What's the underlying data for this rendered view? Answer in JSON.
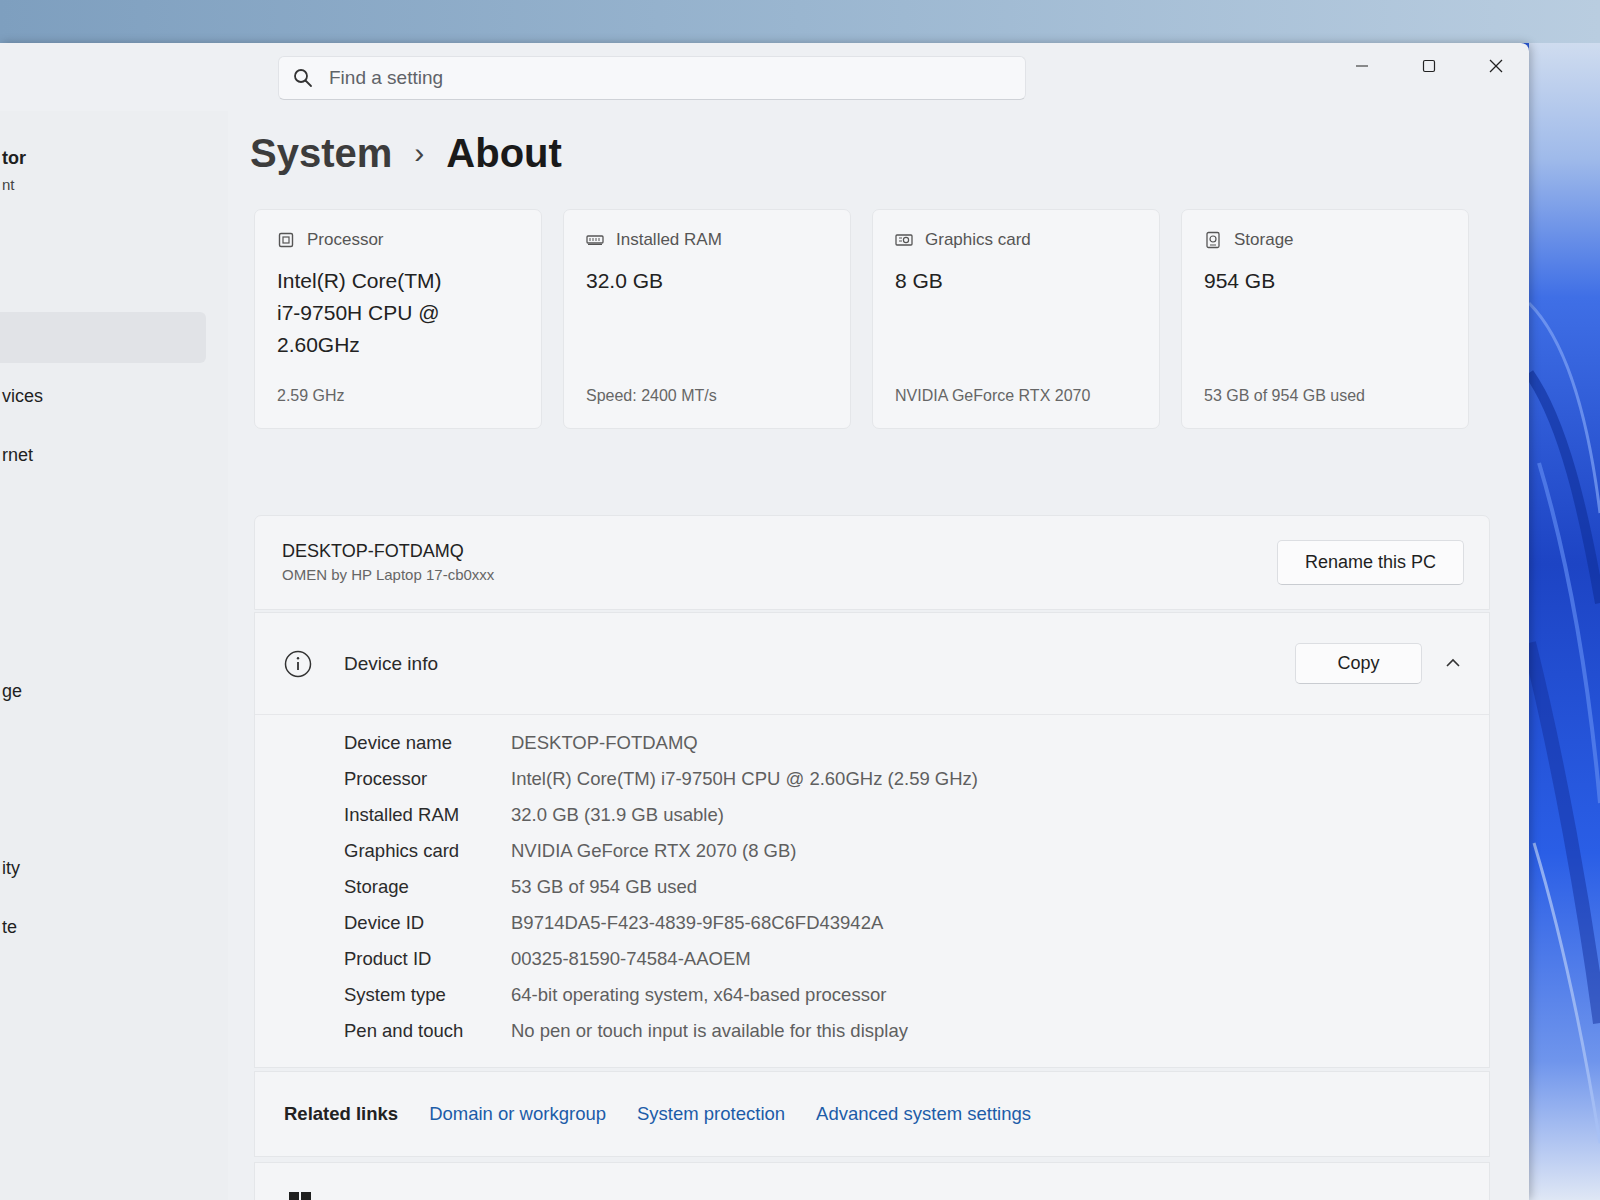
{
  "search": {
    "placeholder": "Find a setting"
  },
  "sidebar": {
    "profile": {
      "name": "tor",
      "account": "nt"
    },
    "items": [
      {
        "label": "",
        "selected": true
      },
      {
        "label": "vices",
        "selected": false
      },
      {
        "label": "rnet",
        "selected": false
      },
      {
        "label": "",
        "selected": false
      },
      {
        "label": "",
        "selected": false
      },
      {
        "label": "",
        "selected": false
      },
      {
        "label": "ge",
        "selected": false
      },
      {
        "label": "",
        "selected": false
      },
      {
        "label": "",
        "selected": false
      },
      {
        "label": "ity",
        "selected": false
      },
      {
        "label": "te",
        "selected": false
      }
    ]
  },
  "breadcrumb": {
    "parent": "System",
    "separator": "›",
    "current": "About"
  },
  "specs": [
    {
      "kind": "processor",
      "label": "Processor",
      "value_lines": [
        "Intel(R) Core(TM)",
        "i7-9750H CPU @",
        "2.60GHz"
      ],
      "detail": "2.59 GHz"
    },
    {
      "kind": "ram",
      "label": "Installed RAM",
      "value_lines": [
        "32.0 GB"
      ],
      "detail": "Speed: 2400 MT/s"
    },
    {
      "kind": "graphics",
      "label": "Graphics card",
      "value_lines": [
        "8 GB"
      ],
      "detail": "NVIDIA GeForce RTX 2070"
    },
    {
      "kind": "storage",
      "label": "Storage",
      "value_lines": [
        "954 GB"
      ],
      "detail": "53 GB of 954 GB used"
    }
  ],
  "device": {
    "name": "DESKTOP-FOTDAMQ",
    "model": "OMEN by HP Laptop 17-cb0xxx",
    "rename_button": "Rename this PC"
  },
  "device_info": {
    "title": "Device info",
    "copy_button": "Copy",
    "expanded": true,
    "rows": [
      [
        "Device name",
        "DESKTOP-FOTDAMQ"
      ],
      [
        "Processor",
        "Intel(R) Core(TM) i7-9750H CPU @ 2.60GHz (2.59 GHz)"
      ],
      [
        "Installed RAM",
        "32.0 GB (31.9 GB usable)"
      ],
      [
        "Graphics card",
        "NVIDIA GeForce RTX 2070 (8 GB)"
      ],
      [
        "Storage",
        "53 GB of 954 GB used"
      ],
      [
        "Device ID",
        "B9714DA5-F423-4839-9F85-68C6FD43942A"
      ],
      [
        "Product ID",
        "00325-81590-74584-AAOEM"
      ],
      [
        "System type",
        "64-bit operating system, x64-based processor"
      ],
      [
        "Pen and touch",
        "No pen or touch input is available for this display"
      ]
    ]
  },
  "related_links": {
    "label": "Related links",
    "links": [
      "Domain or workgroup",
      "System protection",
      "Advanced system settings"
    ]
  }
}
